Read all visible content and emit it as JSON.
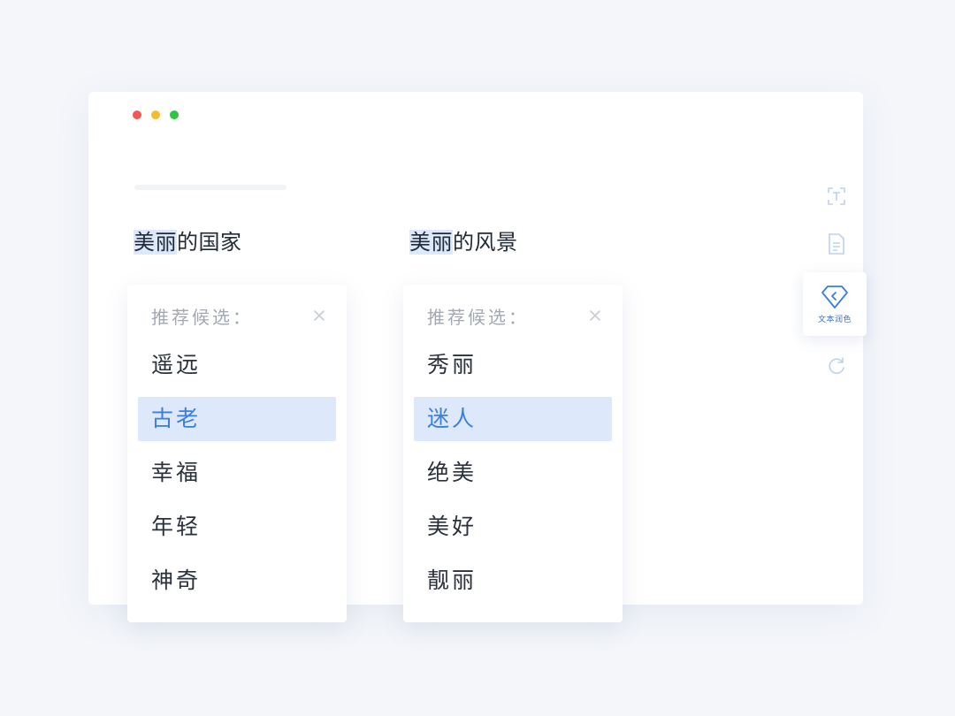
{
  "document": {
    "line1": {
      "highlight": "美丽",
      "rest": "的国家"
    },
    "line2": {
      "highlight": "美丽",
      "rest": "的风景"
    }
  },
  "suggestion_panels": [
    {
      "title": "推荐候选：",
      "options": [
        "遥远",
        "古老",
        "幸福",
        "年轻",
        "神奇"
      ],
      "selected_index": 1
    },
    {
      "title": "推荐候选：",
      "options": [
        "秀丽",
        "迷人",
        "绝美",
        "美好",
        "靓丽"
      ],
      "selected_index": 1
    }
  ],
  "sidebar": {
    "tools": [
      {
        "icon": "text-scan-icon",
        "label": ""
      },
      {
        "icon": "document-icon",
        "label": ""
      },
      {
        "icon": "diamond-polish-icon",
        "label": "文本润色",
        "active": true
      },
      {
        "icon": "refresh-icon",
        "label": ""
      }
    ]
  },
  "colors": {
    "accent": "#3a7ee0",
    "highlight": "#dde9fb",
    "text": "#2a313c",
    "muted": "#a3a9b3"
  }
}
